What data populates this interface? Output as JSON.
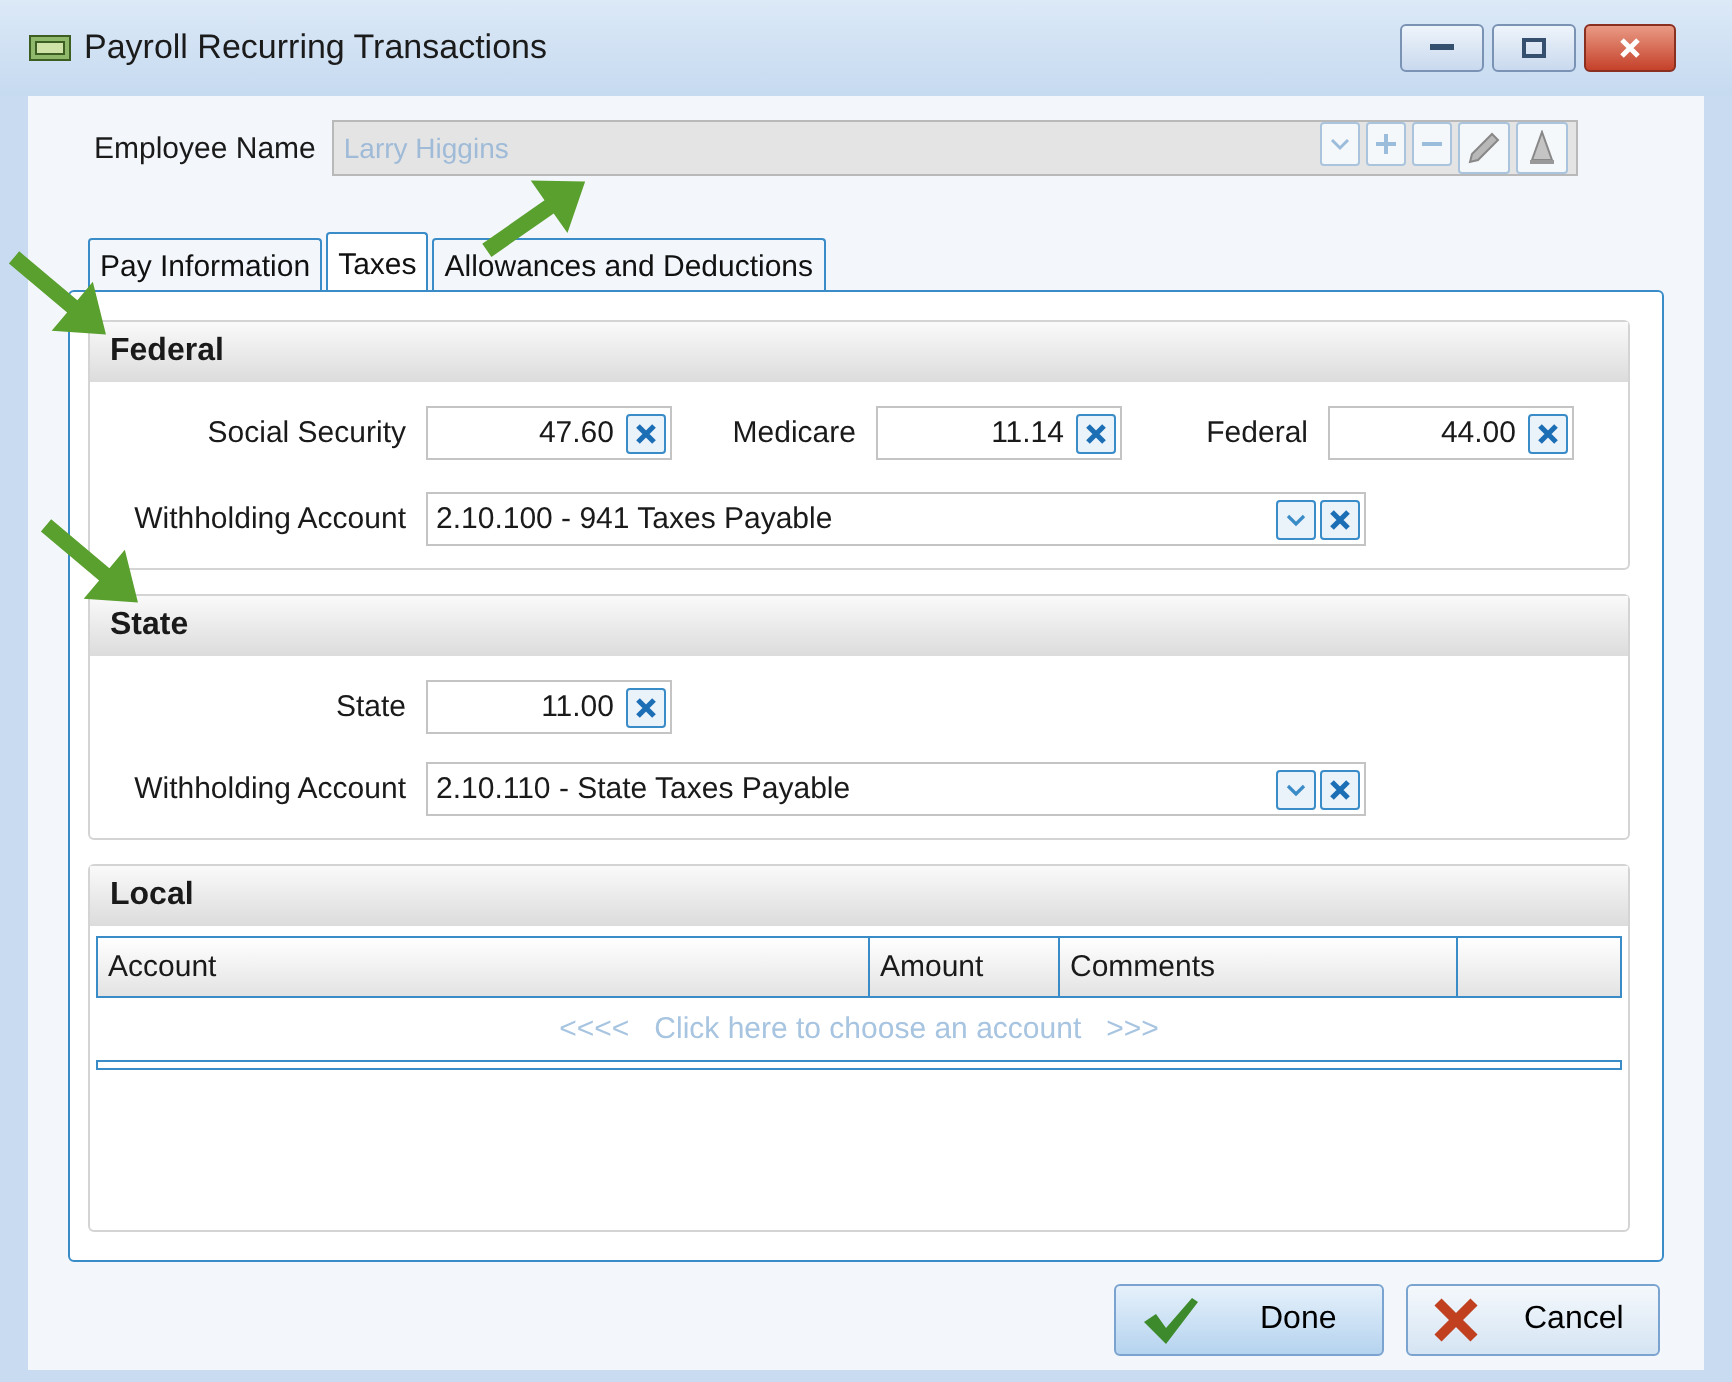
{
  "window": {
    "title": "Payroll Recurring Transactions"
  },
  "employee": {
    "label": "Employee Name",
    "value": "Larry Higgins",
    "disabled": true
  },
  "tabs": [
    {
      "label": "Pay Information",
      "selected": false
    },
    {
      "label": "Taxes",
      "selected": true
    },
    {
      "label": "Allowances and Deductions",
      "selected": false
    }
  ],
  "federal": {
    "title": "Federal",
    "amounts": [
      {
        "label": "Social Security",
        "value": "47.60"
      },
      {
        "label": "Medicare",
        "value": "11.14"
      },
      {
        "label": "Federal",
        "value": "44.00"
      }
    ],
    "account": {
      "label": "Withholding Account",
      "value": "2.10.100 - 941 Taxes Payable"
    }
  },
  "state": {
    "title": "State",
    "amounts": [
      {
        "label": "State",
        "value": "11.00"
      }
    ],
    "account": {
      "label": "Withholding Account",
      "value": "2.10.110 - State Taxes Payable"
    }
  },
  "local": {
    "title": "Local",
    "columns": [
      "Account",
      "Amount",
      "Comments"
    ],
    "hint": "<<<<   Click here to choose an account   >>>"
  },
  "buttons": [
    {
      "label": "Done",
      "kind": "done"
    },
    {
      "label": "Cancel",
      "kind": "cancel"
    }
  ]
}
